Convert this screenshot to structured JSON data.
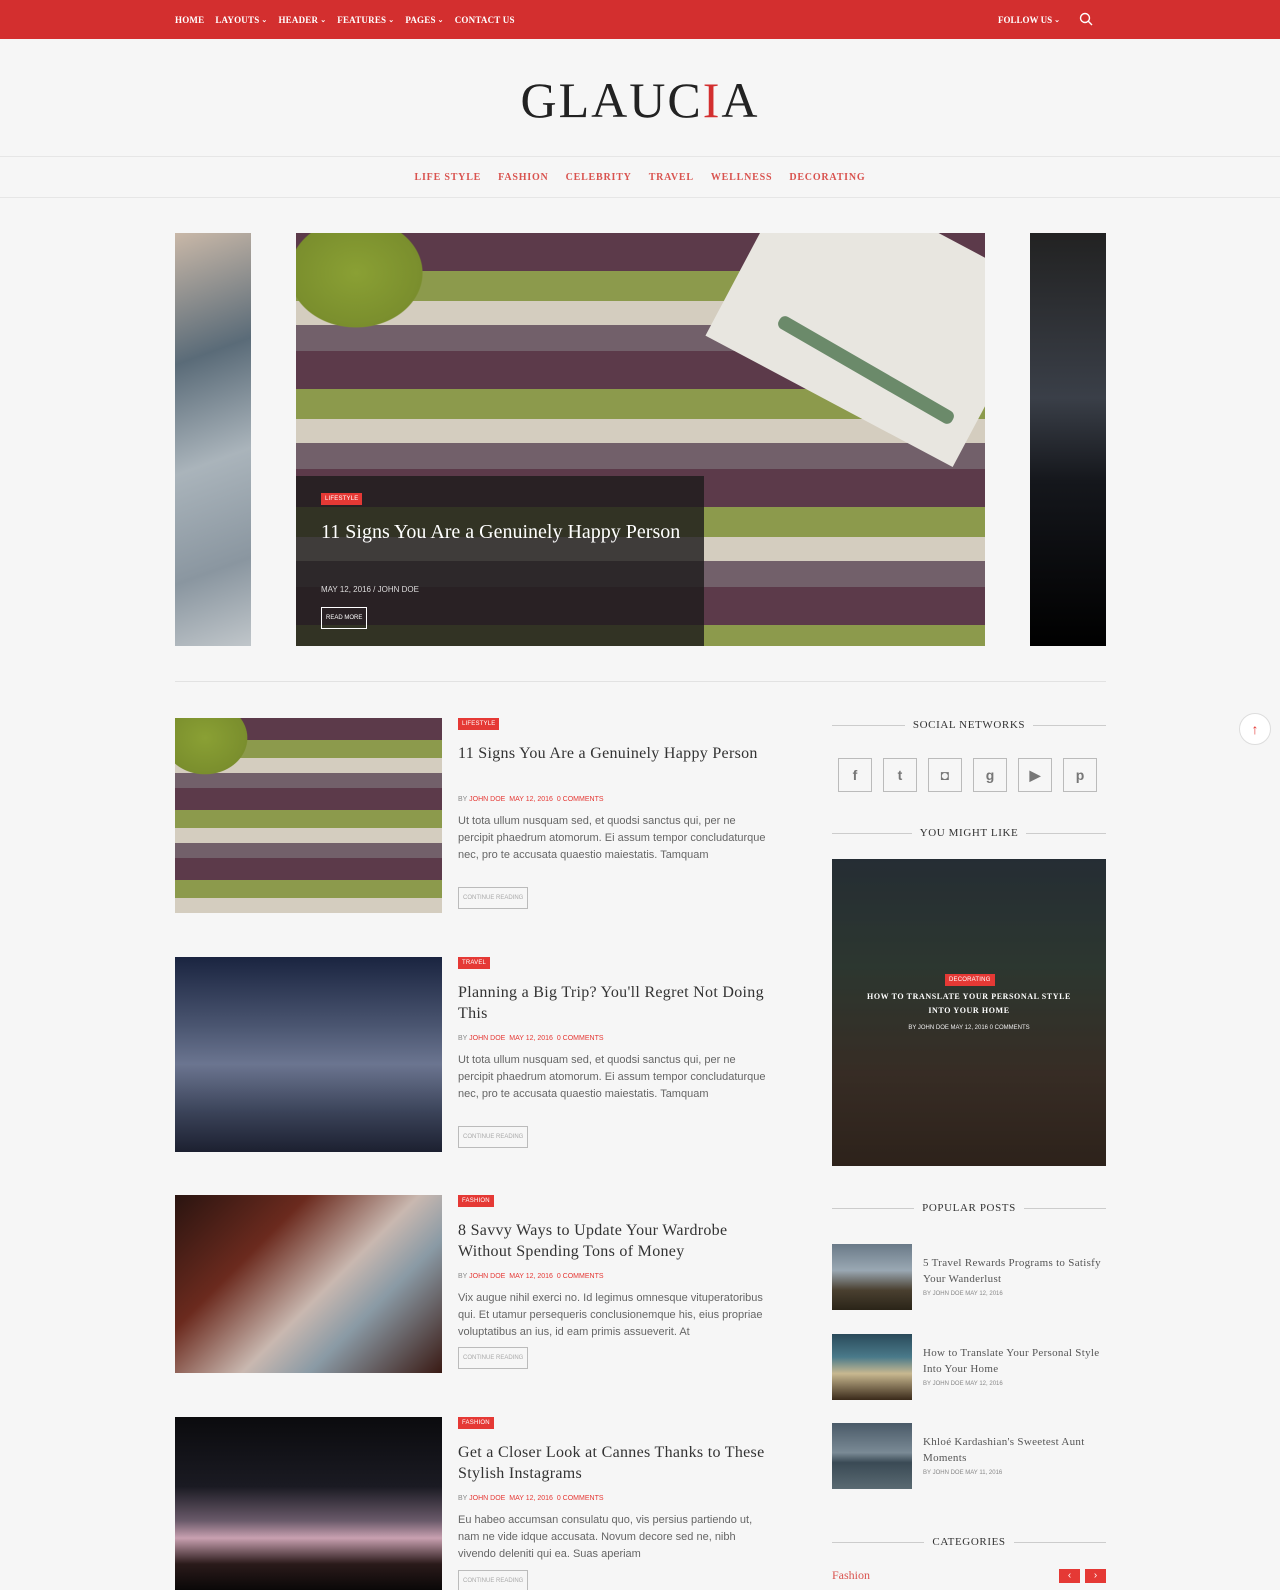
{
  "topnav": {
    "items": [
      {
        "label": "HOME",
        "caret": false
      },
      {
        "label": "LAYOUTS",
        "caret": true
      },
      {
        "label": "HEADER",
        "caret": true
      },
      {
        "label": "FEATURES",
        "caret": true
      },
      {
        "label": "PAGES",
        "caret": true
      },
      {
        "label": "CONTACT US",
        "caret": false
      }
    ],
    "follow": "FOLLOW US",
    "search_icon": "search-icon"
  },
  "logo": {
    "left": "GLAUC",
    "mark": "I",
    "right": "A"
  },
  "categories": [
    "LIFE STYLE",
    "FASHION",
    "CELEBRITY",
    "TRAVEL",
    "WELLNESS",
    "DECORATING"
  ],
  "hero": {
    "badge": "LIFESTYLE",
    "title": "11 Signs You Are a Genuinely Happy Person",
    "meta": "MAY 12, 2016 / JOHN DOE",
    "button": "READ MORE"
  },
  "posts": [
    {
      "badge": "LIFESTYLE",
      "title": "11 Signs You Are a Genuinely Happy Person",
      "by": "BY",
      "author": "JOHN DOE",
      "date": "MAY 12, 2016",
      "comments": "0 COMMENTS",
      "excerpt": "Ut tota ullum nusquam sed, et quodsi sanctus qui, per ne percipit phaedrum atomorum. Ei assum tempor concludaturque nec, pro te accusata quaestio maiestatis. Tamquam",
      "cta": "CONTINUE READING"
    },
    {
      "badge": "TRAVEL",
      "title": "Planning a Big Trip? You'll Regret Not Doing This",
      "by": "BY",
      "author": "JOHN DOE",
      "date": "MAY 12, 2016",
      "comments": "0 COMMENTS",
      "excerpt": "Ut tota ullum nusquam sed, et quodsi sanctus qui, per ne percipit phaedrum atomorum. Ei assum tempor concludaturque nec, pro te accusata quaestio maiestatis. Tamquam",
      "cta": "CONTINUE READING"
    },
    {
      "badge": "FASHION",
      "title": "8 Savvy Ways to Update Your Wardrobe Without Spending Tons of Money",
      "by": "BY",
      "author": "JOHN DOE",
      "date": "MAY 12, 2016",
      "comments": "0 COMMENTS",
      "excerpt": "Vix augue nihil exerci no. Id legimus omnesque vituperatoribus qui. Et utamur persequeris conclusionemque his, eius propriae voluptatibus an ius, id eam primis assueverit. At",
      "cta": "CONTINUE READING"
    },
    {
      "badge": "FASHION",
      "title": "Get a Closer Look at Cannes Thanks to These Stylish Instagrams",
      "by": "BY",
      "author": "JOHN DOE",
      "date": "MAY 12, 2016",
      "comments": "0 COMMENTS",
      "excerpt": "Eu habeo accumsan consulatu quo, vis persius partiendo ut, nam ne vide idque accusata. Novum decore sed ne, nibh vivendo deleniti qui ea. Suas aperiam",
      "cta": "CONTINUE READING"
    }
  ],
  "sidebar": {
    "social_title": "SOCIAL NETWORKS",
    "social": [
      {
        "icon": "facebook-icon",
        "glyph": "f"
      },
      {
        "icon": "twitter-icon",
        "glyph": "t"
      },
      {
        "icon": "instagram-icon",
        "glyph": "◘"
      },
      {
        "icon": "google-plus-icon",
        "glyph": "g"
      },
      {
        "icon": "youtube-icon",
        "glyph": "▶"
      },
      {
        "icon": "pinterest-icon",
        "glyph": "p"
      }
    ],
    "might_title": "YOU MIGHT LIKE",
    "might": {
      "badge": "DECORATING",
      "title": "HOW TO TRANSLATE YOUR PERSONAL STYLE INTO YOUR HOME",
      "meta": "BY JOHN DOE   MAY 12, 2016   0 COMMENTS"
    },
    "popular_title": "POPULAR POSTS",
    "popular": [
      {
        "title": "5 Travel Rewards Programs to Satisfy Your Wanderlust",
        "meta": "BY JOHN DOE   MAY 12, 2016"
      },
      {
        "title": "How to Translate Your Personal Style Into Your Home",
        "meta": "BY JOHN DOE   MAY 12, 2016"
      },
      {
        "title": "Khloé Kardashian's Sweetest Aunt Moments",
        "meta": "BY JOHN DOE   MAY 11, 2016"
      }
    ],
    "categories_title": "CATEGORIES",
    "category_current": "Fashion",
    "prev": "‹",
    "next": "›"
  },
  "totop": "↑",
  "colors": {
    "accent": "#d32f2f",
    "badge": "#e53935",
    "nav_link": "#d9534f"
  }
}
